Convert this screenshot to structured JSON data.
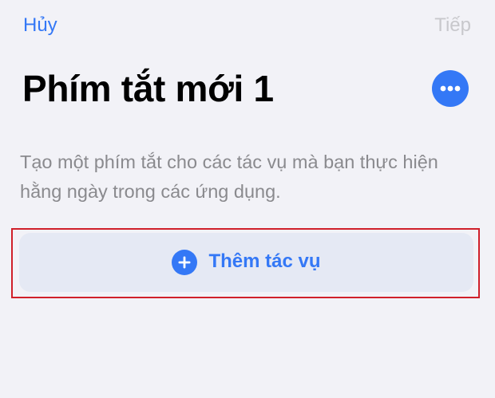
{
  "nav": {
    "cancel_label": "Hủy",
    "next_label": "Tiếp"
  },
  "header": {
    "title": "Phím tắt mới 1",
    "more_icon": "ellipsis-icon"
  },
  "main": {
    "description": "Tạo một phím tắt cho các tác vụ mà bạn thực hiện hằng ngày trong các ứng dụng.",
    "add_action_label": "Thêm tác vụ",
    "add_action_icon": "plus-circle-icon"
  },
  "colors": {
    "accent": "#3478f6",
    "disabled": "#c8c8cc",
    "background": "#f2f2f7",
    "button_background": "#e5e9f4",
    "highlight_border": "#d0202a"
  }
}
